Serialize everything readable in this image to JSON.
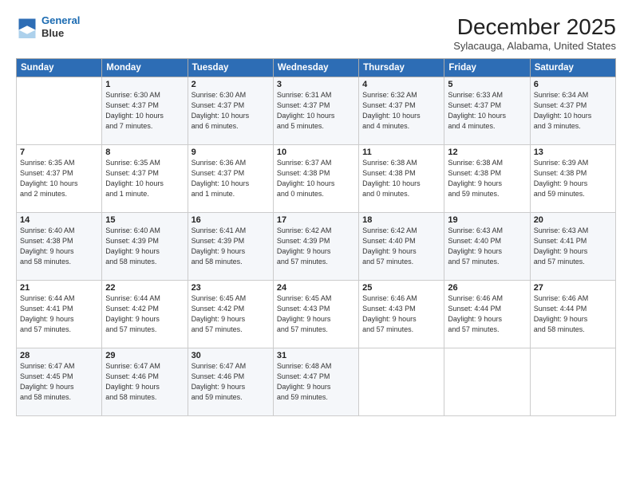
{
  "header": {
    "logo_line1": "General",
    "logo_line2": "Blue",
    "month": "December 2025",
    "location": "Sylacauga, Alabama, United States"
  },
  "days_of_week": [
    "Sunday",
    "Monday",
    "Tuesday",
    "Wednesday",
    "Thursday",
    "Friday",
    "Saturday"
  ],
  "weeks": [
    [
      {
        "day": "",
        "info": ""
      },
      {
        "day": "1",
        "info": "Sunrise: 6:30 AM\nSunset: 4:37 PM\nDaylight: 10 hours\nand 7 minutes."
      },
      {
        "day": "2",
        "info": "Sunrise: 6:30 AM\nSunset: 4:37 PM\nDaylight: 10 hours\nand 6 minutes."
      },
      {
        "day": "3",
        "info": "Sunrise: 6:31 AM\nSunset: 4:37 PM\nDaylight: 10 hours\nand 5 minutes."
      },
      {
        "day": "4",
        "info": "Sunrise: 6:32 AM\nSunset: 4:37 PM\nDaylight: 10 hours\nand 4 minutes."
      },
      {
        "day": "5",
        "info": "Sunrise: 6:33 AM\nSunset: 4:37 PM\nDaylight: 10 hours\nand 4 minutes."
      },
      {
        "day": "6",
        "info": "Sunrise: 6:34 AM\nSunset: 4:37 PM\nDaylight: 10 hours\nand 3 minutes."
      }
    ],
    [
      {
        "day": "7",
        "info": "Sunrise: 6:35 AM\nSunset: 4:37 PM\nDaylight: 10 hours\nand 2 minutes."
      },
      {
        "day": "8",
        "info": "Sunrise: 6:35 AM\nSunset: 4:37 PM\nDaylight: 10 hours\nand 1 minute."
      },
      {
        "day": "9",
        "info": "Sunrise: 6:36 AM\nSunset: 4:37 PM\nDaylight: 10 hours\nand 1 minute."
      },
      {
        "day": "10",
        "info": "Sunrise: 6:37 AM\nSunset: 4:38 PM\nDaylight: 10 hours\nand 0 minutes."
      },
      {
        "day": "11",
        "info": "Sunrise: 6:38 AM\nSunset: 4:38 PM\nDaylight: 10 hours\nand 0 minutes."
      },
      {
        "day": "12",
        "info": "Sunrise: 6:38 AM\nSunset: 4:38 PM\nDaylight: 9 hours\nand 59 minutes."
      },
      {
        "day": "13",
        "info": "Sunrise: 6:39 AM\nSunset: 4:38 PM\nDaylight: 9 hours\nand 59 minutes."
      }
    ],
    [
      {
        "day": "14",
        "info": "Sunrise: 6:40 AM\nSunset: 4:38 PM\nDaylight: 9 hours\nand 58 minutes."
      },
      {
        "day": "15",
        "info": "Sunrise: 6:40 AM\nSunset: 4:39 PM\nDaylight: 9 hours\nand 58 minutes."
      },
      {
        "day": "16",
        "info": "Sunrise: 6:41 AM\nSunset: 4:39 PM\nDaylight: 9 hours\nand 58 minutes."
      },
      {
        "day": "17",
        "info": "Sunrise: 6:42 AM\nSunset: 4:39 PM\nDaylight: 9 hours\nand 57 minutes."
      },
      {
        "day": "18",
        "info": "Sunrise: 6:42 AM\nSunset: 4:40 PM\nDaylight: 9 hours\nand 57 minutes."
      },
      {
        "day": "19",
        "info": "Sunrise: 6:43 AM\nSunset: 4:40 PM\nDaylight: 9 hours\nand 57 minutes."
      },
      {
        "day": "20",
        "info": "Sunrise: 6:43 AM\nSunset: 4:41 PM\nDaylight: 9 hours\nand 57 minutes."
      }
    ],
    [
      {
        "day": "21",
        "info": "Sunrise: 6:44 AM\nSunset: 4:41 PM\nDaylight: 9 hours\nand 57 minutes."
      },
      {
        "day": "22",
        "info": "Sunrise: 6:44 AM\nSunset: 4:42 PM\nDaylight: 9 hours\nand 57 minutes."
      },
      {
        "day": "23",
        "info": "Sunrise: 6:45 AM\nSunset: 4:42 PM\nDaylight: 9 hours\nand 57 minutes."
      },
      {
        "day": "24",
        "info": "Sunrise: 6:45 AM\nSunset: 4:43 PM\nDaylight: 9 hours\nand 57 minutes."
      },
      {
        "day": "25",
        "info": "Sunrise: 6:46 AM\nSunset: 4:43 PM\nDaylight: 9 hours\nand 57 minutes."
      },
      {
        "day": "26",
        "info": "Sunrise: 6:46 AM\nSunset: 4:44 PM\nDaylight: 9 hours\nand 57 minutes."
      },
      {
        "day": "27",
        "info": "Sunrise: 6:46 AM\nSunset: 4:44 PM\nDaylight: 9 hours\nand 58 minutes."
      }
    ],
    [
      {
        "day": "28",
        "info": "Sunrise: 6:47 AM\nSunset: 4:45 PM\nDaylight: 9 hours\nand 58 minutes."
      },
      {
        "day": "29",
        "info": "Sunrise: 6:47 AM\nSunset: 4:46 PM\nDaylight: 9 hours\nand 58 minutes."
      },
      {
        "day": "30",
        "info": "Sunrise: 6:47 AM\nSunset: 4:46 PM\nDaylight: 9 hours\nand 59 minutes."
      },
      {
        "day": "31",
        "info": "Sunrise: 6:48 AM\nSunset: 4:47 PM\nDaylight: 9 hours\nand 59 minutes."
      },
      {
        "day": "",
        "info": ""
      },
      {
        "day": "",
        "info": ""
      },
      {
        "day": "",
        "info": ""
      }
    ]
  ]
}
